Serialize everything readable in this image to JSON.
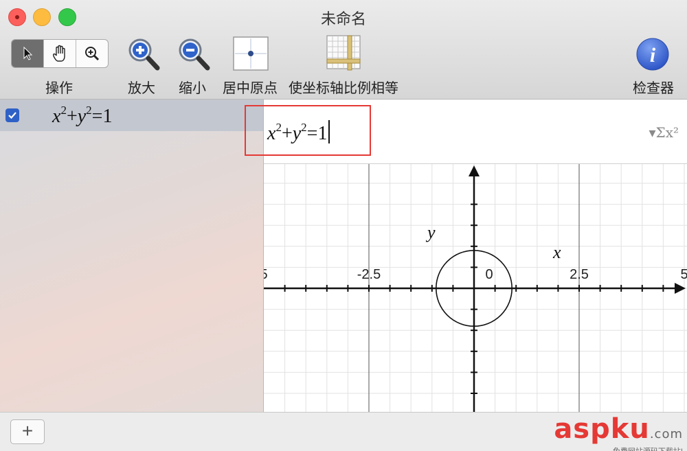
{
  "window": {
    "title": "未命名"
  },
  "toolbar": {
    "actions_label": "操作",
    "zoom_in_label": "放大",
    "zoom_out_label": "缩小",
    "center_origin_label": "居中原点",
    "equal_axes_label": "使坐标轴比例相等",
    "inspector_label": "检查器",
    "inspector_glyph": "i"
  },
  "sidebar": {
    "equations": [
      {
        "checked": true,
        "x": "x",
        "p1": "2",
        "op": "+",
        "y": "y",
        "p2": "2",
        "rhs": "=1"
      }
    ]
  },
  "editor": {
    "x": "x",
    "p1": "2",
    "op": "+",
    "y": "y",
    "p2": "2",
    "rhs": "=1",
    "format_glyph": "▾Σx²"
  },
  "graph": {
    "x_label": "x",
    "y_label": "y",
    "tick_labels": [
      "5",
      "-2.5",
      "0",
      "2.5",
      "5"
    ],
    "grid_step": 0.5,
    "x_range": [
      -5,
      5
    ],
    "circle_radius": 1
  },
  "footer": {
    "add_label": "+",
    "watermark": "aspku",
    "watermark_suffix": ".com",
    "watermark_sub": "免费网站源码下载站!"
  },
  "colors": {
    "accent": "#2e61c6",
    "highlight_box": "#e53935",
    "inspector_blue": "#3a63d6"
  }
}
